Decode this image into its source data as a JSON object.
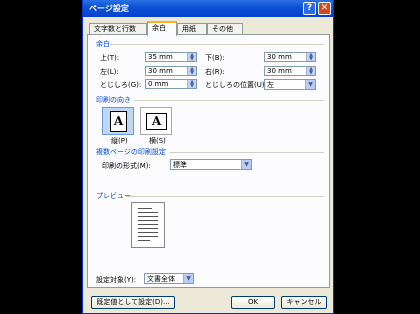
{
  "dialog": {
    "title": "ページ設定",
    "help_glyph": "?",
    "close_glyph": "✕"
  },
  "tabs": [
    "文字数と行数",
    "余白",
    "用紙",
    "その他"
  ],
  "margins": {
    "section_label": "余白",
    "top_label": "上(T):",
    "top_value": "35 mm",
    "bottom_label": "下(B):",
    "bottom_value": "30 mm",
    "left_label": "左(L):",
    "left_value": "30 mm",
    "right_label": "右(R):",
    "right_value": "30 mm",
    "gutter_label": "とじしろ(G):",
    "gutter_value": "0 mm",
    "gutter_pos_label": "とじしろの位置(U):",
    "gutter_pos_value": "左"
  },
  "orientation": {
    "section_label": "印刷の向き",
    "portrait_label": "縦(P)",
    "landscape_label": "横(S)",
    "glyph": "A"
  },
  "multiple_pages": {
    "section_label": "複数ページの印刷設定",
    "label": "印刷の形式(M):",
    "value": "標準"
  },
  "preview": {
    "section_label": "プレビュー",
    "apply_label": "設定対象(Y):",
    "apply_value": "文書全体"
  },
  "buttons": {
    "default": "既定値として設定(D)...",
    "ok": "OK",
    "cancel": "キャンセル"
  },
  "colors": {
    "titlebar": "#0a4fd6",
    "section_text": "#0046d5",
    "dialog_bg": "#ece9d8"
  }
}
